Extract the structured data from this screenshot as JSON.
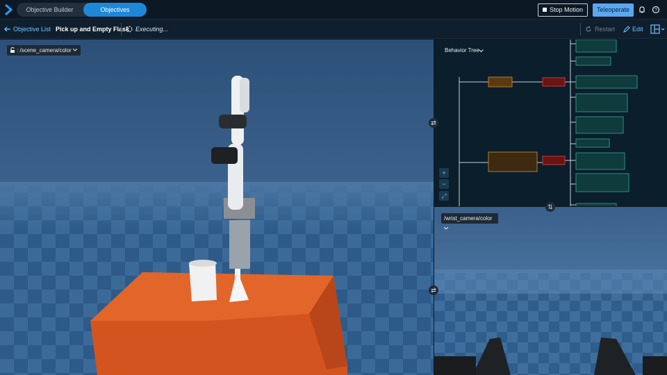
{
  "header": {
    "mode_tabs": [
      {
        "label": "Objective Builder"
      },
      {
        "label": "Objectives"
      }
    ],
    "stop_label": "Stop Motion",
    "teleoperate_label": "Teleoperate"
  },
  "toolbar": {
    "back_label": "Objective List",
    "objective_title": "Pick up and Empty Flask",
    "status": "Executing...",
    "restart_label": "Restart",
    "edit_label": "Edit"
  },
  "views": {
    "scene_camera": "/scene_camera/color",
    "wrist_camera": "/wrist_camera/color"
  },
  "behavior_tree": {
    "label": "Behavior Tree"
  },
  "colors": {
    "accent": "#1e88d8",
    "table": "#e2652a",
    "floor": "#3b6a99"
  }
}
